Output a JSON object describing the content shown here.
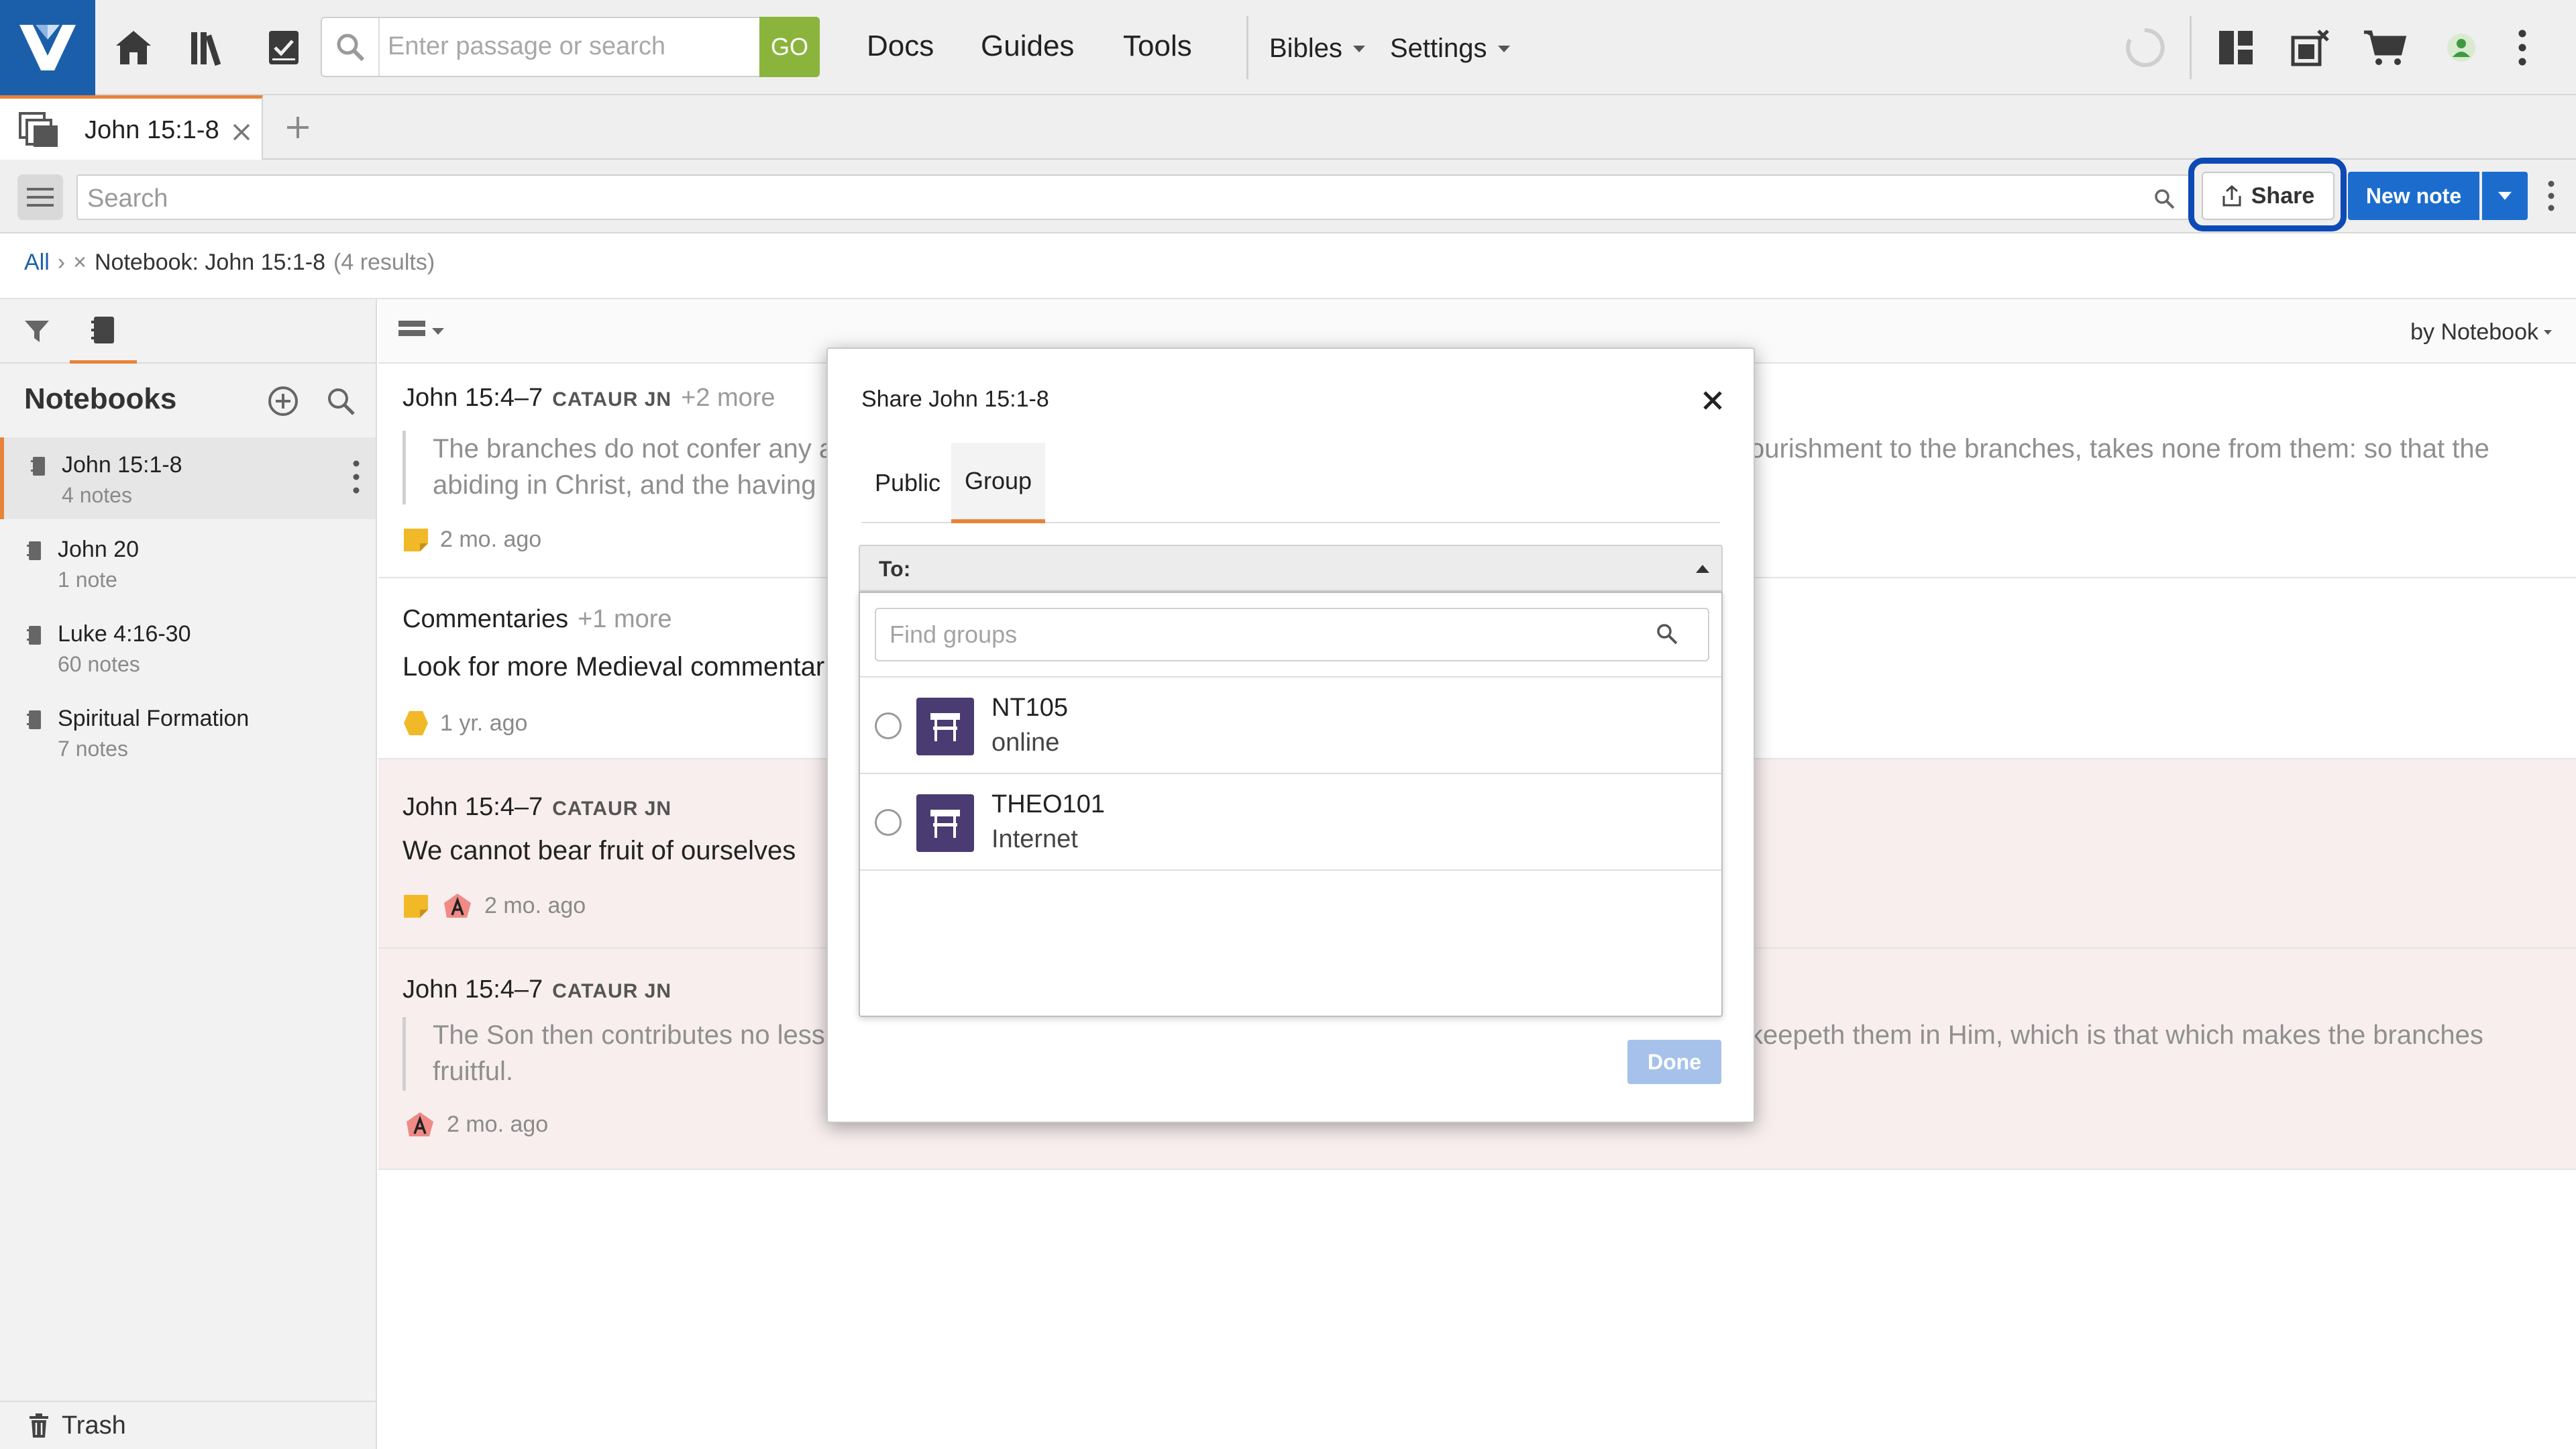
{
  "topbar": {
    "search_placeholder": "Enter passage or search",
    "go_label": "GO",
    "nav": [
      "Docs",
      "Guides",
      "Tools"
    ],
    "bibles_label": "Bibles",
    "settings_label": "Settings"
  },
  "tabs": {
    "doc_tab_label": "John 15:1-8"
  },
  "toolbar": {
    "search_placeholder": "Search",
    "share_label": "Share",
    "new_note_label": "New note"
  },
  "breadcrumb": {
    "all": "All",
    "separator": "›",
    "remove": "×",
    "current": "Notebook: John 15:1-8",
    "results": "(4 results)"
  },
  "sidebar": {
    "heading": "Notebooks",
    "notebooks": [
      {
        "title": "John 15:1-8",
        "count": "4 notes"
      },
      {
        "title": "John 20",
        "count": "1 note"
      },
      {
        "title": "Luke 4:16-30",
        "count": "60 notes"
      },
      {
        "title": "Spiritual Formation",
        "count": "7 notes"
      }
    ],
    "trash_label": "Trash"
  },
  "list": {
    "sort_label": "by Notebook",
    "notes": [
      {
        "ref": "John 15:4–7",
        "source": "CATAUR JN",
        "more": "+2 more",
        "quote_left": "The branches do not confer any a",
        "quote_left2": "abiding in Christ, and the having",
        "quote_right": "ourishment to the branches, takes none from them: so that the",
        "time": "2 mo. ago"
      },
      {
        "ref": "Commentaries",
        "more": "+1 more",
        "body": "Look for more Medieval commentar",
        "time": "1 yr. ago"
      },
      {
        "ref": "John 15:4–7",
        "source": "CATAUR JN",
        "body": "We cannot bear fruit of ourselves",
        "time": "2 mo. ago"
      },
      {
        "ref": "John 15:4–7",
        "source": "CATAUR JN",
        "quote_left": "The Son then contributes no less",
        "quote_left2": "fruitful.",
        "quote_right": "keepeth them in Him, which is that which makes the branches",
        "time": "2 mo. ago"
      }
    ]
  },
  "dialog": {
    "title": "Share John 15:1-8",
    "tabs": [
      "Public",
      "Group"
    ],
    "to_label": "To:",
    "find_placeholder": "Find groups",
    "groups": [
      {
        "name": "NT105",
        "sub": "online"
      },
      {
        "name": "THEO101",
        "sub": "Internet"
      }
    ],
    "done_label": "Done"
  },
  "colors": {
    "brand_blue": "#1b5faa",
    "accent_orange": "#e8833a",
    "go_green": "#8ab43c",
    "share_highlight": "#0d4ab5",
    "group_avatar": "#4a3b72"
  },
  "icons": [
    "logo-icon",
    "home-icon",
    "library-icon",
    "checklist-icon",
    "search-icon",
    "sync-icon",
    "layout-icon",
    "close-panels-icon",
    "cart-icon",
    "user-icon",
    "more-icon",
    "tab-icon",
    "add-tab-icon",
    "menu-icon",
    "share-icon",
    "filter-icon",
    "notebook-icon",
    "add-icon",
    "trash-icon",
    "close-icon",
    "group-icon"
  ]
}
